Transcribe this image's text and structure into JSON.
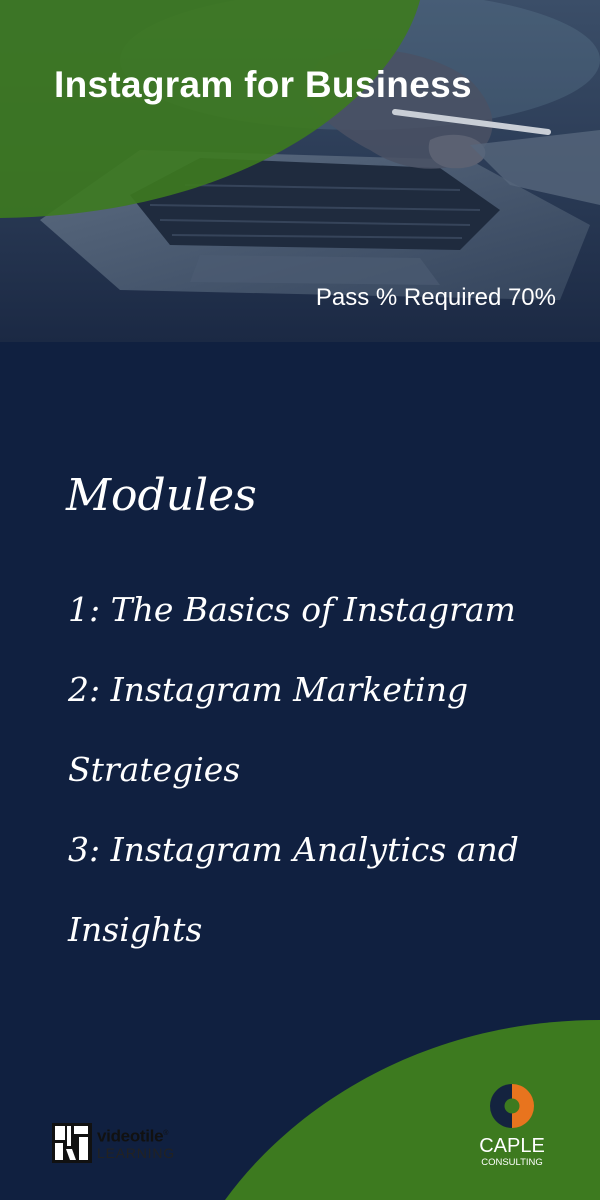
{
  "hero": {
    "title": "Instagram for Business",
    "pass_text": "Pass % Required 70%"
  },
  "modules": {
    "heading": "Modules",
    "items": [
      "1: The Basics of Instagram",
      "2: Instagram Marketing Strategies",
      "3: Instagram Analytics and Insights"
    ]
  },
  "logos": {
    "videotile": {
      "line1": "videotile",
      "trademark": "®",
      "line2": "LEARNING"
    },
    "caple": {
      "name": "CAPLE",
      "subtitle": "CONSULTING"
    }
  },
  "colors": {
    "background": "#102040",
    "accent_green": "#3d7a1f",
    "accent_orange": "#e8741e",
    "text": "#ffffff"
  }
}
